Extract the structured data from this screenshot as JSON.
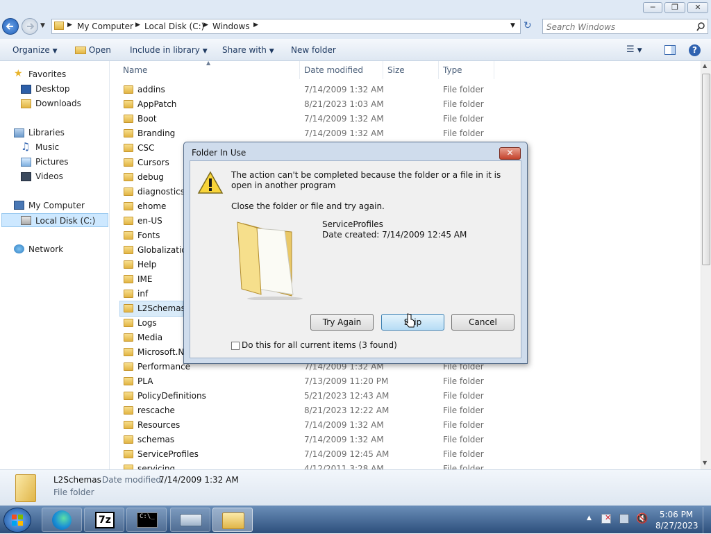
{
  "window": {
    "caption_buttons": [
      "minimize-icon",
      "restore-icon",
      "close-icon"
    ]
  },
  "address": {
    "crumbs": [
      "My Computer",
      "Local Disk (C:)",
      "Windows"
    ],
    "search_placeholder": "Search Windows"
  },
  "toolbar": {
    "organize": "Organize",
    "open": "Open",
    "include": "Include in library",
    "share": "Share with",
    "new_folder": "New folder"
  },
  "sidebar": {
    "favorites": "Favorites",
    "desktop": "Desktop",
    "downloads": "Downloads",
    "libraries": "Libraries",
    "music": "Music",
    "pictures": "Pictures",
    "videos": "Videos",
    "computer": "My Computer",
    "local_disk": "Local Disk (C:)",
    "network": "Network"
  },
  "columns": {
    "name": "Name",
    "date": "Date modified",
    "size": "Size",
    "type": "Type"
  },
  "files": [
    {
      "name": "addins",
      "date": "7/14/2009 1:32 AM",
      "type": "File folder"
    },
    {
      "name": "AppPatch",
      "date": "8/21/2023 1:03 AM",
      "type": "File folder"
    },
    {
      "name": "Boot",
      "date": "7/14/2009 1:32 AM",
      "type": "File folder"
    },
    {
      "name": "Branding",
      "date": "7/14/2009 1:32 AM",
      "type": "File folder"
    },
    {
      "name": "CSC",
      "date": "",
      "type": ""
    },
    {
      "name": "Cursors",
      "date": "",
      "type": ""
    },
    {
      "name": "debug",
      "date": "",
      "type": ""
    },
    {
      "name": "diagnostics",
      "date": "",
      "type": ""
    },
    {
      "name": "ehome",
      "date": "",
      "type": ""
    },
    {
      "name": "en-US",
      "date": "",
      "type": ""
    },
    {
      "name": "Fonts",
      "date": "",
      "type": ""
    },
    {
      "name": "Globalization",
      "date": "",
      "type": ""
    },
    {
      "name": "Help",
      "date": "",
      "type": ""
    },
    {
      "name": "IME",
      "date": "",
      "type": ""
    },
    {
      "name": "inf",
      "date": "",
      "type": ""
    },
    {
      "name": "L2Schemas",
      "date": "",
      "type": ""
    },
    {
      "name": "Logs",
      "date": "",
      "type": ""
    },
    {
      "name": "Media",
      "date": "",
      "type": ""
    },
    {
      "name": "Microsoft.NET",
      "date": "",
      "type": ""
    },
    {
      "name": "Performance",
      "date": "7/14/2009 1:32 AM",
      "type": "File folder"
    },
    {
      "name": "PLA",
      "date": "7/13/2009 11:20 PM",
      "type": "File folder"
    },
    {
      "name": "PolicyDefinitions",
      "date": "5/21/2023 12:43 AM",
      "type": "File folder"
    },
    {
      "name": "rescache",
      "date": "8/21/2023 12:22 AM",
      "type": "File folder"
    },
    {
      "name": "Resources",
      "date": "7/14/2009 1:32 AM",
      "type": "File folder"
    },
    {
      "name": "schemas",
      "date": "7/14/2009 1:32 AM",
      "type": "File folder"
    },
    {
      "name": "ServiceProfiles",
      "date": "7/14/2009 12:45 AM",
      "type": "File folder"
    },
    {
      "name": "servicing",
      "date": "4/12/2011 3:28 AM",
      "type": "File folder"
    }
  ],
  "details": {
    "name": "L2Schemas",
    "date_label": "Date modified:",
    "date_value": "7/14/2009 1:32 AM",
    "type": "File folder"
  },
  "dialog": {
    "title": "Folder In Use",
    "message": "The action can't be completed because the folder or a file in it is open in another program",
    "instruction": "Close the folder or file and try again.",
    "item_name": "ServiceProfiles",
    "item_date": "Date created: 7/14/2009 12:45 AM",
    "try_again": "Try Again",
    "skip": "Skip",
    "cancel": "Cancel",
    "checkbox": "Do this for all current items (3 found)",
    "checkbox_checked": false
  },
  "taskbar": {
    "time": "5:06 PM",
    "date": "8/27/2023",
    "apps": [
      "start-orb-icon",
      "edge-icon",
      "7zip-icon",
      "cmd-icon",
      "keyboard-icon",
      "explorer-icon"
    ]
  },
  "colors": {
    "accent": "#1e3961",
    "selection": "#cde8ff",
    "taskbar": "#2d4f7c"
  }
}
